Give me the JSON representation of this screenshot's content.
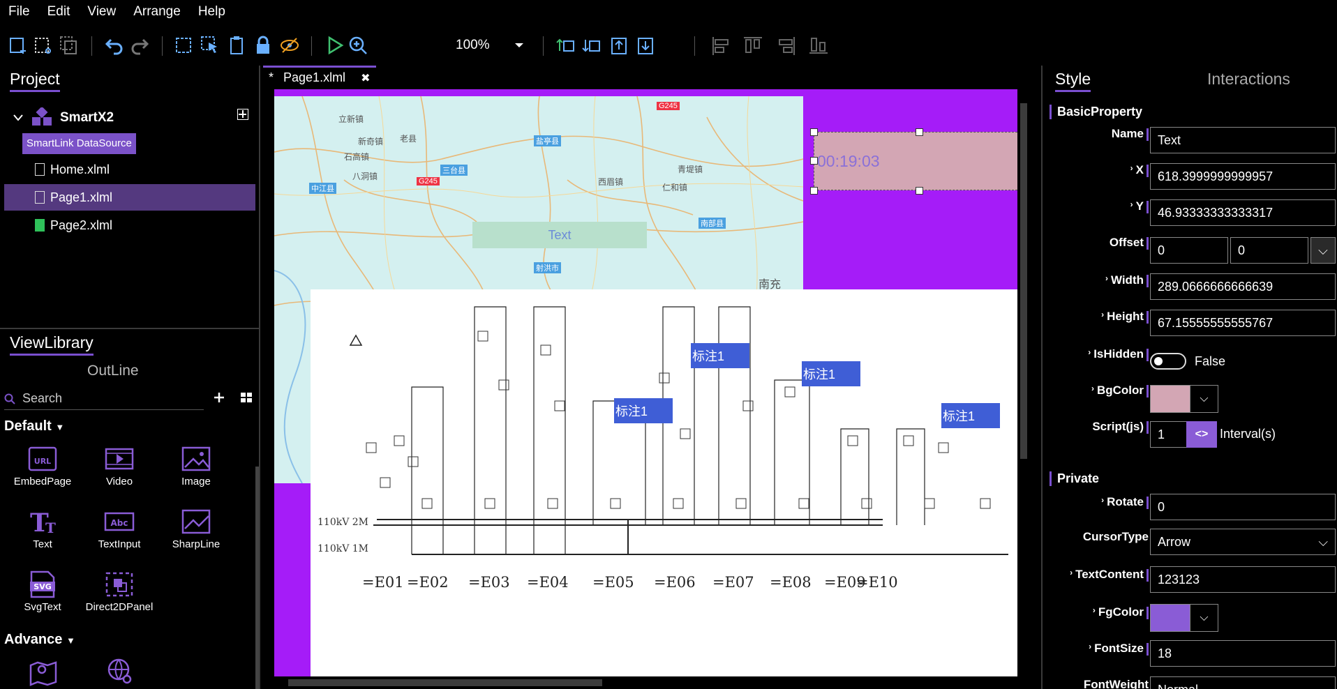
{
  "menu": [
    "File",
    "Edit",
    "View",
    "Arrange",
    "Help"
  ],
  "toolbar": {
    "zoom": "100%",
    "accent": "#7b52c8"
  },
  "project": {
    "title": "Project",
    "root": "SmartX2",
    "datasource": "SmartLink DataSource",
    "pages": [
      "Home.xlml",
      "Page1.xlml",
      "Page2.xlml"
    ]
  },
  "library": {
    "title": "ViewLibrary",
    "outline": "OutLine",
    "search_placeholder": "Search",
    "default_section": "Default",
    "advance_section": "Advance",
    "items": [
      "EmbedPage",
      "Video",
      "Image",
      "Text",
      "TextInput",
      "SharpLine",
      "SvgText",
      "Direct2DPanel"
    ]
  },
  "editor": {
    "tab_modified": "*",
    "tab_name": "Page1.xlml",
    "map_text": "Text",
    "time_text": "00:19:03",
    "map_places": [
      "立新镇",
      "新奇镇",
      "石高镇",
      "八洞镇",
      "老县",
      "南充",
      "中江县",
      "射洪市",
      "西眉镇",
      "三台县",
      "盐亭县",
      "仁和镇",
      "青堤镇",
      "南部县"
    ],
    "annotations": [
      "标注1",
      "标注1",
      "标注1",
      "标注1"
    ],
    "bus_labels": [
      "110kV 2M",
      "110kV 1M"
    ],
    "column_labels": [
      "=E01",
      "=E02",
      "=E03",
      "=E04",
      "=E05",
      "=E06",
      "=E07",
      "=E08",
      "=E09",
      "=E10"
    ],
    "canvas_bg": "#a51cf8"
  },
  "properties": {
    "tab_style": "Style",
    "tab_interactions": "Interactions",
    "basic_header": "BasicProperty",
    "private_header": "Private",
    "name_label": "Name",
    "name_value": "Text",
    "x_label": "X",
    "x_value": "618.3999999999957",
    "y_label": "Y",
    "y_value": "46.93333333333317",
    "offset_label": "Offset",
    "offset_x": "0",
    "offset_y": "0",
    "width_label": "Width",
    "width_value": "289.0666666666639",
    "height_label": "Height",
    "height_value": "67.15555555555767",
    "hidden_label": "IsHidden",
    "hidden_value": "False",
    "bgcolor_label": "BgColor",
    "bgcolor": "#d3a6b4",
    "script_label": "Script(js)",
    "script_value": "1",
    "script_btn": "<>",
    "interval_label": "Interval(s)",
    "rotate_label": "Rotate",
    "rotate_value": "0",
    "cursor_label": "CursorType",
    "cursor_value": "Arrow",
    "textcontent_label": "TextContent",
    "textcontent_value": "123123",
    "fgcolor_label": "FgColor",
    "fgcolor": "#8a5cd6",
    "fontsize_label": "FontSize",
    "fontsize_value": "18",
    "fontweight_label": "FontWeight",
    "fontweight_value": "Normal"
  }
}
